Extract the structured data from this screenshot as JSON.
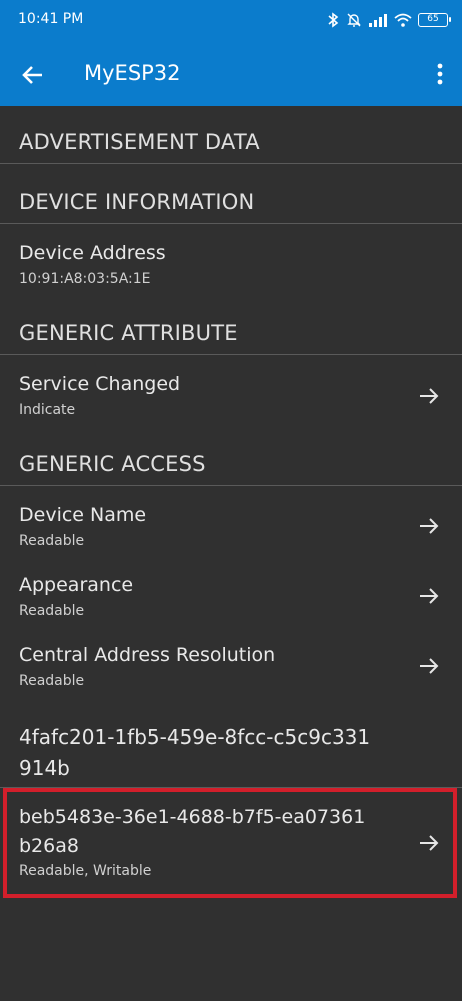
{
  "status_bar": {
    "time": "10:41 PM",
    "battery": "65",
    "icons": [
      "bluetooth-icon",
      "bell-off-icon",
      "signal-icon",
      "wifi-icon",
      "battery-icon"
    ]
  },
  "app_bar": {
    "title": "MyESP32",
    "back_icon": "arrow-back-icon",
    "menu_icon": "more-vertical-icon"
  },
  "sections": {
    "advertisement": {
      "title": "ADVERTISEMENT DATA"
    },
    "device_information": {
      "title": "DEVICE INFORMATION",
      "items": [
        {
          "name": "Device Address",
          "value": "10:91:A8:03:5A:1E"
        }
      ]
    },
    "generic_attribute": {
      "title": "GENERIC ATTRIBUTE",
      "items": [
        {
          "name": "Service Changed",
          "props": "Indicate"
        }
      ]
    },
    "generic_access": {
      "title": "GENERIC ACCESS",
      "items": [
        {
          "name": "Device Name",
          "props": "Readable"
        },
        {
          "name": "Appearance",
          "props": "Readable"
        },
        {
          "name": "Central Address Resolution",
          "props": "Readable"
        }
      ]
    },
    "custom_service": {
      "uuid_line1": "4fafc201-1fb5-459e-8fcc-c5c9c331",
      "uuid_line2": "914b",
      "characteristic": {
        "uuid_line1": "beb5483e-36e1-4688-b7f5-ea07361",
        "uuid_line2": "b26a8",
        "props": "Readable, Writable"
      }
    }
  },
  "colors": {
    "app_bar": "#0b7ccc",
    "background": "#303030",
    "highlight_border": "#d21f2b"
  }
}
